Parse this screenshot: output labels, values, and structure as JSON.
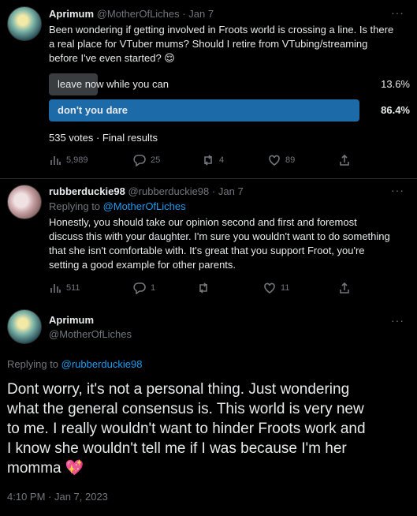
{
  "tweet1": {
    "name": "Aprimum",
    "handle": "@MotherOfLiches",
    "sep": "·",
    "date": "Jan 7",
    "text_line1": "Been wondering if getting involved in Froots world is crossing a line. Is there",
    "text_line2": "a real place for VTuber mums? Should I retire from VTubing/streaming",
    "text_line3": "before I've even started? 😌",
    "poll": {
      "options": [
        {
          "label": "leave now while you can",
          "percent": "13.6%",
          "fraction": 0.136
        },
        {
          "label": "don't you dare",
          "percent": "86.4%",
          "fraction": 0.864
        }
      ],
      "summary": "535 votes · Final results"
    },
    "actions": {
      "views": "5,989",
      "replies": "25",
      "retweets": "4",
      "likes": "89"
    }
  },
  "tweet2": {
    "name": "rubberduckie98",
    "handle": "@rubberduckie98",
    "sep": "·",
    "date": "Jan 7",
    "replying_prefix": "Replying to ",
    "replying_to": "@MotherOfLiches",
    "text_line1": "Honestly, you should take our opinion second and first and foremost",
    "text_line2": "discuss this with your daughter. I'm sure you wouldn't want to do something",
    "text_line3": "that she isn't comfortable with. It's great that you support Froot, you're",
    "text_line4": "setting a good example for other parents.",
    "actions": {
      "views": "511",
      "replies": "1",
      "retweets": "",
      "likes": "11"
    }
  },
  "tweet3": {
    "name": "Aprimum",
    "handle": "@MotherOfLiches",
    "replying_prefix": "Replying to ",
    "replying_to": "@rubberduckie98",
    "text_line1": "Dont worry, it's not a personal thing. Just wondering",
    "text_line2": "what the general consensus is. This world is very new",
    "text_line3": "to me. I really wouldn't want to hinder Froots work and",
    "text_line4": "I know she wouldn't tell me if I was because I'm her",
    "text_line5": "momma 💖",
    "timestamp": "4:10 PM · Jan 7, 2023"
  },
  "colors": {
    "background": "#000000",
    "accent": "#1d9bf0",
    "poll_winner": "#1d6aa8",
    "poll_loser": "#3a3d40",
    "muted": "#71767b"
  },
  "icons": [
    "views-icon",
    "reply-icon",
    "retweet-icon",
    "like-icon",
    "share-icon",
    "more-icon"
  ]
}
